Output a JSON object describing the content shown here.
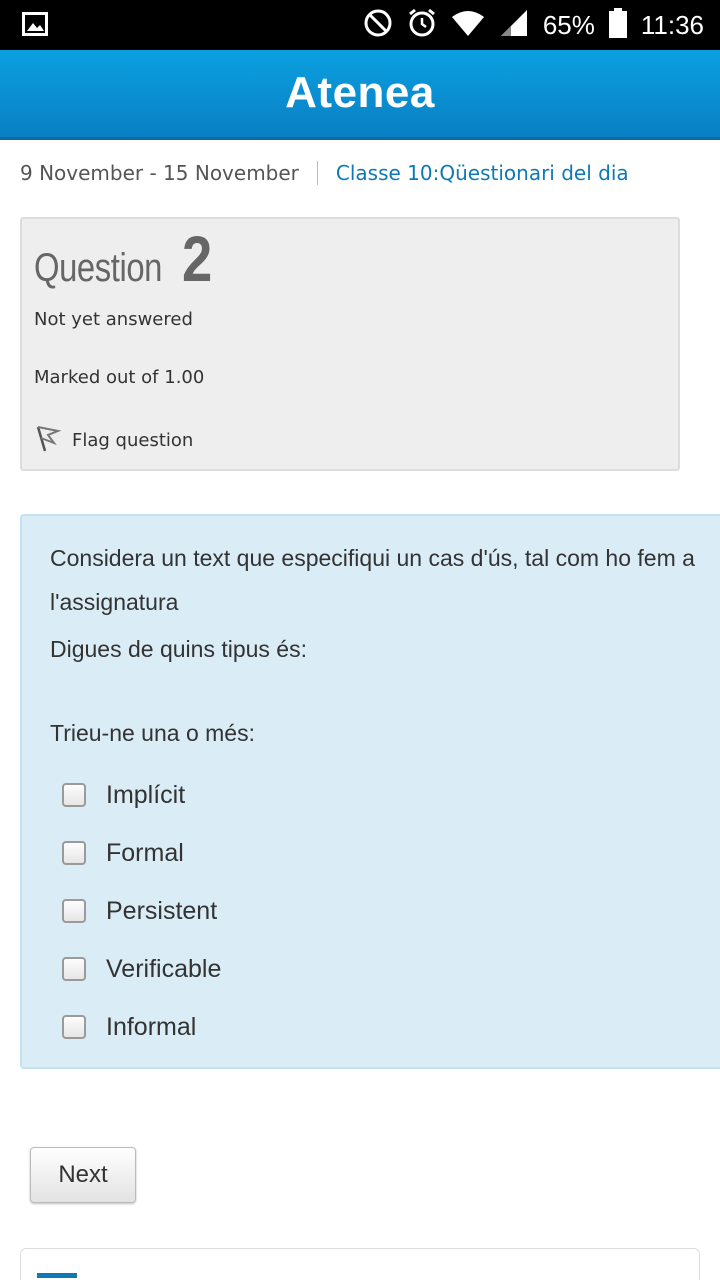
{
  "status_bar": {
    "battery_percent": "65%",
    "time": "11:36",
    "icons": [
      "image-icon",
      "do-not-disturb-icon",
      "alarm-icon",
      "wifi-icon",
      "signal-icon",
      "battery-icon"
    ]
  },
  "header": {
    "title": "Atenea"
  },
  "breadcrumb": {
    "week": "9 November - 15 November",
    "link": "Classe 10:Qüestionari del dia"
  },
  "question_info": {
    "label": "Question",
    "number": "2",
    "state": "Not yet answered",
    "mark": "Marked out of 1.00",
    "flag_label": "Flag question"
  },
  "question": {
    "text_line1": "Considera un text que especifiqui un cas d'ús, tal com ho fem a l'assignatura",
    "text_line2": "Digues de quins tipus és:",
    "prompt": "Trieu-ne una o més:",
    "options": [
      {
        "label": "Implícit",
        "checked": false
      },
      {
        "label": "Formal",
        "checked": false
      },
      {
        "label": "Persistent",
        "checked": false
      },
      {
        "label": "Verificable",
        "checked": false
      },
      {
        "label": "Informal",
        "checked": false
      }
    ]
  },
  "navigation": {
    "next_label": "Next"
  },
  "colors": {
    "accent": "#0a8fd4",
    "link": "#0f79b6",
    "content_bg": "#daecf6",
    "info_bg": "#eeeeee"
  }
}
